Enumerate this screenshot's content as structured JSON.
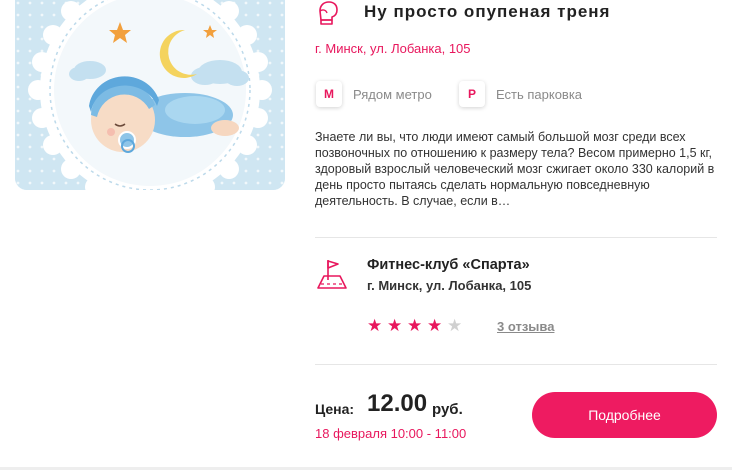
{
  "event": {
    "title": "Ну просто опупеная треня",
    "address": "г. Минск, ул. Лобанка, 105",
    "icon": "boxing-glove-icon",
    "image": "sleeping-baby-illustration"
  },
  "features": [
    {
      "icon": "metro-icon",
      "badge": "М",
      "label": "Рядом метро"
    },
    {
      "icon": "parking-icon",
      "badge": "P",
      "label": "Есть парковка"
    }
  ],
  "description": "Знаете ли вы, что люди имеют самый большой мозг среди всех позвоночных по отношению к размеру тела? Весом примерно 1,5 кг, здоровый взрослый человеческий мозг сжигает около 330 калорий в день просто пытаясь сделать нормальную повседневную деятельность. В случае, если в…",
  "venue": {
    "name": "Фитнес-клуб «Спарта»",
    "address": "г. Минск, ул. Лобанка, 105",
    "icon": "map-pin-icon",
    "rating": 4,
    "rating_max": 5,
    "reviews_label": "3 отзыва"
  },
  "price": {
    "label": "Цена:",
    "value": "12.00",
    "currency": "руб."
  },
  "date": "18 февраля 10:00 - 11:00",
  "actions": {
    "more_label": "Подробнее"
  },
  "colors": {
    "accent": "#ee1b61",
    "accent_text": "#e8175d",
    "star_filled": "#e8175d",
    "star_empty": "#d0d0d0",
    "muted": "#8a8a8a"
  }
}
